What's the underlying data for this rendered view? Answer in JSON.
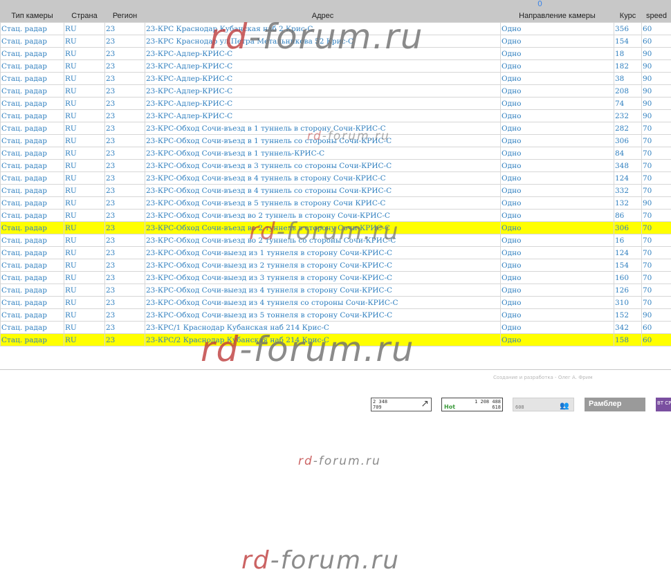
{
  "pager": {
    "page_link": "0"
  },
  "table": {
    "headers": [
      "Тип камеры",
      "Страна",
      "Регион",
      "Адрес",
      "Направление камеры",
      "Курс",
      "speed"
    ],
    "rows": [
      {
        "type": "Стац. радар",
        "country": "RU",
        "region": "23",
        "address": "23-КРС Краснодар Кубанская наб 2 Крис-С",
        "direction": "Одно",
        "course": "356",
        "speed": "60",
        "highlight": false
      },
      {
        "type": "Стац. радар",
        "country": "RU",
        "region": "23",
        "address": "23-КРС Краснодар ул.Петра Метальникова 52 Крис-С",
        "direction": "Одно",
        "course": "154",
        "speed": "60",
        "highlight": false
      },
      {
        "type": "Стац. радар",
        "country": "RU",
        "region": "23",
        "address": "23-КРС-Адлер-КРИС-С",
        "direction": "Одно",
        "course": "18",
        "speed": "90",
        "highlight": false
      },
      {
        "type": "Стац. радар",
        "country": "RU",
        "region": "23",
        "address": "23-КРС-Адлер-КРИС-С",
        "direction": "Одно",
        "course": "182",
        "speed": "90",
        "highlight": false
      },
      {
        "type": "Стац. радар",
        "country": "RU",
        "region": "23",
        "address": "23-КРС-Адлер-КРИС-С",
        "direction": "Одно",
        "course": "38",
        "speed": "90",
        "highlight": false
      },
      {
        "type": "Стац. радар",
        "country": "RU",
        "region": "23",
        "address": "23-КРС-Адлер-КРИС-С",
        "direction": "Одно",
        "course": "208",
        "speed": "90",
        "highlight": false
      },
      {
        "type": "Стац. радар",
        "country": "RU",
        "region": "23",
        "address": "23-КРС-Адлер-КРИС-С",
        "direction": "Одно",
        "course": "74",
        "speed": "90",
        "highlight": false
      },
      {
        "type": "Стац. радар",
        "country": "RU",
        "region": "23",
        "address": "23-КРС-Адлер-КРИС-С",
        "direction": "Одно",
        "course": "232",
        "speed": "90",
        "highlight": false
      },
      {
        "type": "Стац. радар",
        "country": "RU",
        "region": "23",
        "address": "23-КРС-Обход Сочи-въезд в 1 туннель в сторону Сочи-КРИС-С",
        "direction": "Одно",
        "course": "282",
        "speed": "70",
        "highlight": false
      },
      {
        "type": "Стац. радар",
        "country": "RU",
        "region": "23",
        "address": "23-КРС-Обход Сочи-въезд в 1 туннель со стороны Сочи-КРИС-С",
        "direction": "Одно",
        "course": "306",
        "speed": "70",
        "highlight": false
      },
      {
        "type": "Стац. радар",
        "country": "RU",
        "region": "23",
        "address": "23-КРС-Обход Сочи-въезд в 1 туннель-КРИС-С",
        "direction": "Одно",
        "course": "84",
        "speed": "70",
        "highlight": false
      },
      {
        "type": "Стац. радар",
        "country": "RU",
        "region": "23",
        "address": "23-КРС-Обход Сочи-въезд в 3 туннель со стороны Сочи-КРИС-С",
        "direction": "Одно",
        "course": "348",
        "speed": "70",
        "highlight": false
      },
      {
        "type": "Стац. радар",
        "country": "RU",
        "region": "23",
        "address": "23-КРС-Обход Сочи-въезд в 4 туннель в сторону Сочи-КРИС-С",
        "direction": "Одно",
        "course": "124",
        "speed": "70",
        "highlight": false
      },
      {
        "type": "Стац. радар",
        "country": "RU",
        "region": "23",
        "address": "23-КРС-Обход Сочи-въезд в 4 туннель со стороны Сочи-КРИС-С",
        "direction": "Одно",
        "course": "332",
        "speed": "70",
        "highlight": false
      },
      {
        "type": "Стац. радар",
        "country": "RU",
        "region": "23",
        "address": "23-КРС-Обход Сочи-въезд в 5 туннель в сторону Сочи КРИС-С",
        "direction": "Одно",
        "course": "132",
        "speed": "90",
        "highlight": false
      },
      {
        "type": "Стац. радар",
        "country": "RU",
        "region": "23",
        "address": "23-КРС-Обход Сочи-въезд во 2 туннель в сторону Сочи-КРИС-С",
        "direction": "Одно",
        "course": "86",
        "speed": "70",
        "highlight": false
      },
      {
        "type": "Стац. радар",
        "country": "RU",
        "region": "23",
        "address": "23-КРС-Обход Сочи-въезд во 2 туннель в сторону Сочи-КРИС-С",
        "direction": "Одно",
        "course": "306",
        "speed": "70",
        "highlight": true
      },
      {
        "type": "Стац. радар",
        "country": "RU",
        "region": "23",
        "address": "23-КРС-Обход Сочи-въезд во 2 туннель со стороны Сочи-КРИС-С",
        "direction": "Одно",
        "course": "16",
        "speed": "70",
        "highlight": false
      },
      {
        "type": "Стац. радар",
        "country": "RU",
        "region": "23",
        "address": "23-КРС-Обход Сочи-выезд из 1 туннеля в сторону Сочи-КРИС-С",
        "direction": "Одно",
        "course": "124",
        "speed": "70",
        "highlight": false
      },
      {
        "type": "Стац. радар",
        "country": "RU",
        "region": "23",
        "address": "23-КРС-Обход Сочи-выезд из 2 туннеля в сторону Сочи-КРИС-С",
        "direction": "Одно",
        "course": "154",
        "speed": "70",
        "highlight": false
      },
      {
        "type": "Стац. радар",
        "country": "RU",
        "region": "23",
        "address": "23-КРС-Обход Сочи-выезд из 3 туннеля в сторону Сочи-КРИС-С",
        "direction": "Одно",
        "course": "160",
        "speed": "70",
        "highlight": false
      },
      {
        "type": "Стац. радар",
        "country": "RU",
        "region": "23",
        "address": "23-КРС-Обход Сочи-выезд из 4 туннеля в сторону Сочи-КРИС-С",
        "direction": "Одно",
        "course": "126",
        "speed": "70",
        "highlight": false
      },
      {
        "type": "Стац. радар",
        "country": "RU",
        "region": "23",
        "address": "23-КРС-Обход Сочи-выезд из 4 туннеля со стороны Сочи-КРИС-С",
        "direction": "Одно",
        "course": "310",
        "speed": "70",
        "highlight": false
      },
      {
        "type": "Стац. радар",
        "country": "RU",
        "region": "23",
        "address": "23-КРС-Обход Сочи-выезд из 5 тоннеля в сторону Сочи-КРИС-С",
        "direction": "Одно",
        "course": "152",
        "speed": "90",
        "highlight": false
      },
      {
        "type": "Стац. радар",
        "country": "RU",
        "region": "23",
        "address": "23-КРС/1 Краснодар Кубанская наб 214 Крис-С",
        "direction": "Одно",
        "course": "342",
        "speed": "60",
        "highlight": false
      },
      {
        "type": "Стац. радар",
        "country": "RU",
        "region": "23",
        "address": "23-КРС/2 Краснодар Кубанская наб 214 Крис-С",
        "direction": "Одно",
        "course": "158",
        "speed": "60",
        "highlight": true
      }
    ]
  },
  "footer": {
    "credit": "Создание и разработка - Олег А. Фрим"
  },
  "counters": {
    "c1_line1": "2 348",
    "c1_line2": "709",
    "c1_icon": "arrow-icon",
    "c2_line1": "1 208 488",
    "c2_line2": "618",
    "c2_logo": "Hot",
    "c3_value": "608",
    "c3_icon": "people-icon",
    "c4_label": "Рамблер",
    "c5_label": "BT CP"
  },
  "watermark": {
    "part1": "rd",
    "part2": "-forum.ru"
  },
  "colors": {
    "link": "#2f7fbf",
    "header_bg": "#c8c8c8",
    "highlight": "#ffff00"
  }
}
